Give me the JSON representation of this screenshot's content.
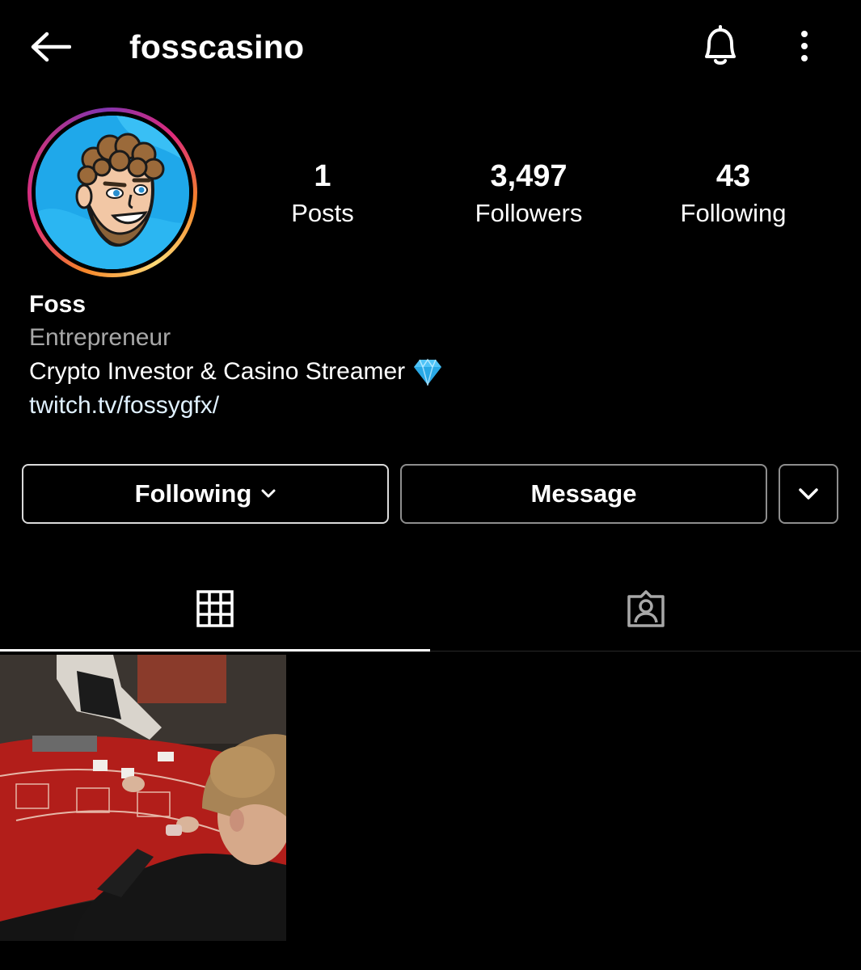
{
  "header": {
    "username": "fosscasino",
    "back_icon": "arrow-left-icon",
    "bell_icon": "bell-icon",
    "more_icon": "more-vertical-icon"
  },
  "profile": {
    "stats": [
      {
        "value": "1",
        "label": "Posts"
      },
      {
        "value": "3,497",
        "label": "Followers"
      },
      {
        "value": "43",
        "label": "Following"
      }
    ],
    "display_name": "Foss",
    "category": "Entrepreneur",
    "bio": "Crypto Investor & Casino Streamer",
    "bio_emoji": "gem-icon",
    "link": "twitch.tv/fossygfx/"
  },
  "actions": {
    "following_label": "Following",
    "message_label": "Message"
  },
  "tabs": [
    {
      "name": "posts-grid",
      "icon": "grid-icon",
      "active": true
    },
    {
      "name": "tagged",
      "icon": "tagged-person-icon",
      "active": false
    }
  ],
  "colors": {
    "background": "#000000",
    "text": "#ffffff",
    "secondary_text": "#a8a8a8",
    "link": "#e0f1ff",
    "avatar_bg": "#1fa8ea"
  }
}
